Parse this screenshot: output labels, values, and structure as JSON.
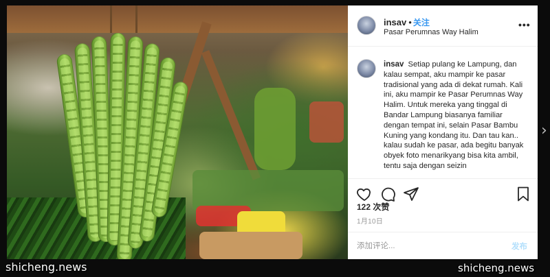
{
  "post": {
    "username": "insav",
    "separator": "•",
    "follow_label": "关注",
    "location": "Pasar Perumnas Way Halim",
    "more_icon": "more-options-icon",
    "more_glyph": "•••"
  },
  "caption": {
    "username": "insav",
    "text": "Setiap pulang ke Lampung, dan kalau sempat, aku mampir ke pasar tradisional yang ada di dekat rumah. Kali ini, aku mampir ke Pasar Perumnas Way Halim. Untuk mereka yang tinggal di Bandar Lampung biasanya familiar dengan tempat ini, selain Pasar Bambu Kuning yang kondang itu. Dan tau kan.. kalau sudah ke pasar, ada begitu banyak obyek foto menarikyang bisa kita ambil, tentu saja dengan seizin"
  },
  "actions": {
    "like_icon": "heart-icon",
    "comment_icon": "comment-bubble-icon",
    "share_icon": "paper-plane-icon",
    "save_icon": "bookmark-icon"
  },
  "likes": "122 次赞",
  "date": "1月10日",
  "comment_box": {
    "placeholder": "添加评论...",
    "post_label": "发布"
  },
  "navigation": {
    "next_icon": "chevron-right-icon",
    "next_glyph": "›"
  },
  "watermarks": {
    "left": "shicheng.news",
    "right": "shicheng.news"
  },
  "colors": {
    "link_blue": "#3897f0",
    "post_disabled": "#b2dffc",
    "panel_bg": "#ffffff",
    "page_bg": "#0b0b0b"
  }
}
